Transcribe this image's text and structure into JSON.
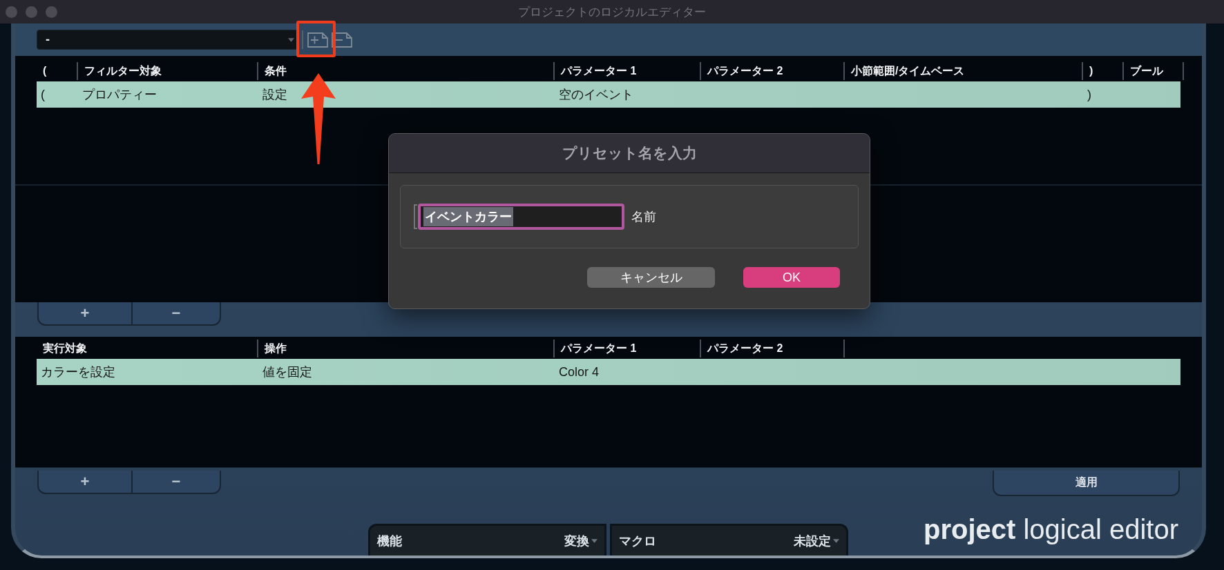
{
  "window": {
    "title": "プロジェクトのロジカルエディター"
  },
  "preset_bar": {
    "preset_value": "-"
  },
  "filter_table": {
    "columns": [
      "(",
      "フィルター対象",
      "条件",
      "パラメーター 1",
      "パラメーター 2",
      "小節範囲/タイムベース",
      ")",
      "ブール"
    ],
    "rows": [
      {
        "selected": true,
        "cells": [
          "(",
          "プロパティー",
          "設定",
          "空のイベント",
          null,
          null,
          ")",
          null
        ]
      }
    ]
  },
  "filter_buttons": [
    "+",
    "−"
  ],
  "action_table": {
    "columns": [
      "実行対象",
      "操作",
      "パラメーター 1",
      "パラメーター 2"
    ],
    "rows": [
      {
        "selected": true,
        "cells": [
          "カラーを設定",
          "値を固定",
          "Color 4",
          null
        ]
      }
    ]
  },
  "action_buttons": [
    "+",
    "−"
  ],
  "apply_button": "適用",
  "function_menu": {
    "label": "機能",
    "value": "変換"
  },
  "macro_menu": {
    "label": "マクロ",
    "value": "未設定"
  },
  "logo": "**project** logical editor",
  "dialog": {
    "title": "プリセット名を入力",
    "field": {
      "value": "イベントカラー",
      "label": "名前",
      "focused": true,
      "text_selected": true
    },
    "buttons": [
      {
        "label": "キャンセル",
        "kind": "secondary"
      },
      {
        "label": "OK",
        "kind": "default"
      }
    ]
  }
}
